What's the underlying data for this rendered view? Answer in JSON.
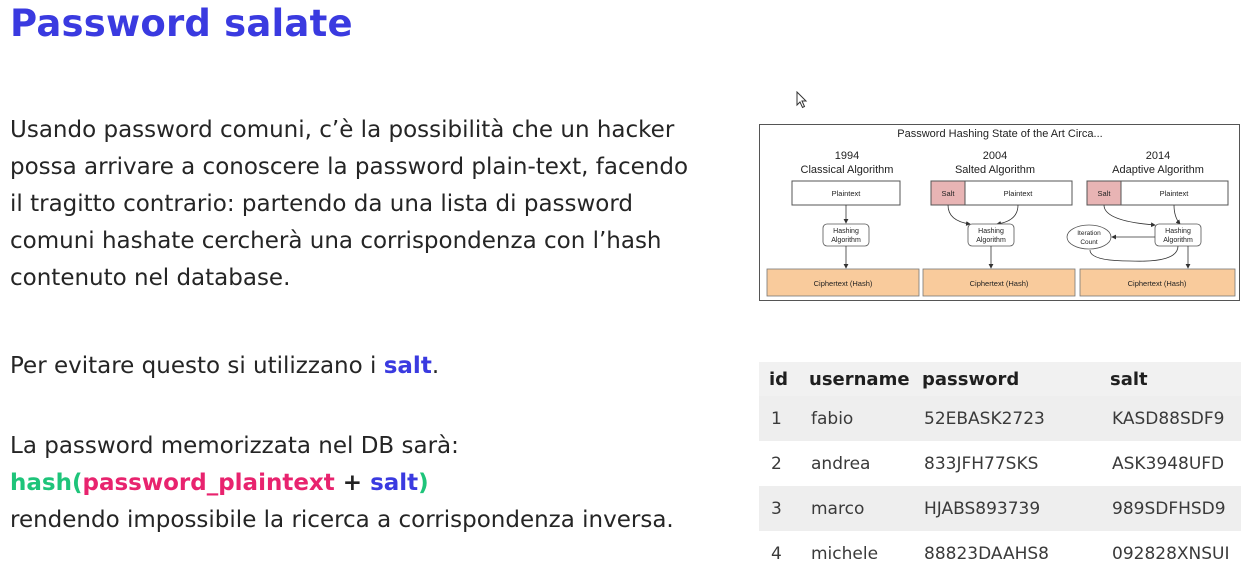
{
  "title": "Password salate",
  "intro": {
    "line1": "Usando password comuni, c’è la possibilità che un hacker",
    "line2": "possa arrivare a conoscere la password plain-text, facendo",
    "line3": "il tragitto contrario: partendo da una lista di password",
    "line4": "comuni hashate cercherà una corrispondenza con l’hash",
    "line5": "contenuto nel database."
  },
  "salt_sentence": {
    "prefix": "Per evitare questo si utilizzano i ",
    "keyword": "salt",
    "suffix": "."
  },
  "formula_block": {
    "line1": "La password memorizzata nel DB sarà:",
    "hash_open": "hash(",
    "plaintext": "password_plaintext",
    "plus": " + ",
    "salt": "salt",
    "hash_close": ")",
    "line3": "rendendo impossibile la ricerca a corrispondenza inversa."
  },
  "diagram": {
    "title": "Password Hashing State of the Art Circa...",
    "columns": [
      {
        "year": "1994",
        "name": "Classical Algorithm",
        "input": "Plaintext",
        "hashing": [
          "Hashing",
          "Algorithm"
        ],
        "output": "Ciphertext (Hash)"
      },
      {
        "year": "2004",
        "name": "Salted Algorithm",
        "salt": "Salt",
        "input": "Plaintext",
        "hashing": [
          "Hashing",
          "Algorithm"
        ],
        "output": "Ciphertext (Hash)"
      },
      {
        "year": "2014",
        "name": "Adaptive Algorithm",
        "salt": "Salt",
        "input": "Plaintext",
        "hashing": [
          "Hashing",
          "Algorithm"
        ],
        "iteration": [
          "Iteration",
          "Count"
        ],
        "output": "Ciphertext (Hash)"
      }
    ],
    "colors": {
      "salt_fill": "#e8b4b4",
      "cipher_fill": "#f9cb9c"
    }
  },
  "table": {
    "headers": [
      "id",
      "username",
      "password",
      "salt"
    ],
    "rows": [
      [
        "1",
        "fabio",
        "52EBASK2723",
        "KASD88SDF9"
      ],
      [
        "2",
        "andrea",
        "833JFH77SKS",
        "ASK3948UFD"
      ],
      [
        "3",
        "marco",
        "HJABS893739",
        "989SDFHSD9"
      ],
      [
        "4",
        "michele",
        "88823DAAHS8",
        "092828XNSUI"
      ]
    ]
  },
  "colors": {
    "accent_blue": "#3a3ae0",
    "green": "#1ec47a",
    "pink": "#e8236e"
  }
}
